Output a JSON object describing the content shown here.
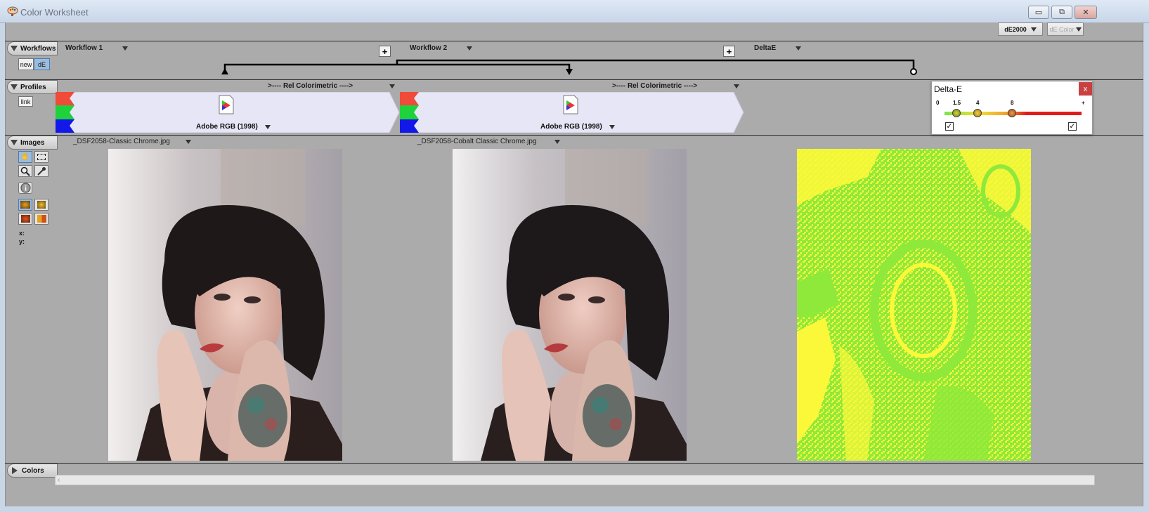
{
  "window": {
    "title": "Color Worksheet",
    "minimize_glyph": "▭",
    "maximize_glyph": "⧉",
    "close_glyph": "✕"
  },
  "toolbar": {
    "metric_select": "dE2000",
    "color_select": "dE Color"
  },
  "sections": {
    "workflows": "Workflows",
    "profiles": "Profiles",
    "images": "Images",
    "colors": "Colors"
  },
  "workflows": {
    "new_label": "new",
    "de_label": "dE",
    "items": [
      {
        "label": "Workflow 1"
      },
      {
        "label": "Workflow 2"
      },
      {
        "label": "DeltaE"
      }
    ],
    "plus_glyph": "+"
  },
  "profiles": {
    "link_label": "link",
    "intents": [
      ">---- Rel Colorimetric ---->",
      ">---- Rel Colorimetric ---->"
    ],
    "names": [
      "Adobe RGB (1998)",
      "Adobe RGB (1998)"
    ]
  },
  "images": {
    "files": [
      "_DSF2058-Classic Chrome.jpg",
      "_DSF2058-Cobalt Classic Chrome.jpg"
    ],
    "coord_x": "x:",
    "coord_y": "y:",
    "tool_icons": [
      "hand-icon",
      "marquee-icon",
      "magnifier-icon",
      "eyedropper-icon",
      "info-icon",
      "view-mode-1-icon",
      "view-mode-2-icon",
      "view-mode-3-icon",
      "view-mode-4-icon"
    ]
  },
  "delta_e": {
    "title": "Delta-E",
    "close": "x",
    "scale_labels": [
      "0",
      "1.5",
      "4",
      "8",
      "+"
    ],
    "thresholds": [
      1.5,
      4,
      8
    ],
    "low_checked": true,
    "high_checked": true
  },
  "colors": {
    "gradient_start": "#7ee34a",
    "gradient_mid": "#f0e030",
    "gradient_end": "#e01c1c",
    "map_green": "#8fe93a",
    "map_yellow": "#fbf83a",
    "profile_fill": "#e6e6f6",
    "swatch_red": "#f04a3a",
    "swatch_green": "#1ed23c",
    "swatch_blue": "#1218e8"
  }
}
